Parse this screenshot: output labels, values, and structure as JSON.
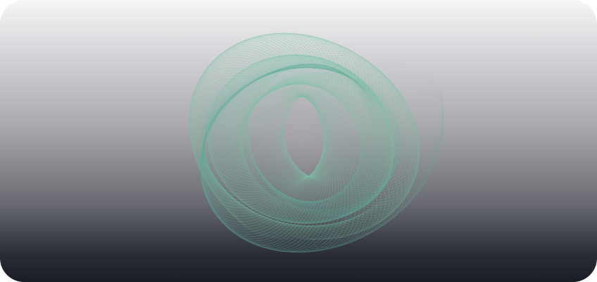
{
  "card": {
    "background_top": "#f6f6f7",
    "background_bottom": "#1b1d26"
  },
  "artwork": {
    "kind": "spirograph",
    "stroke_colors": [
      "#63b8a6",
      "#7cc39a",
      "#4f9c97"
    ]
  }
}
